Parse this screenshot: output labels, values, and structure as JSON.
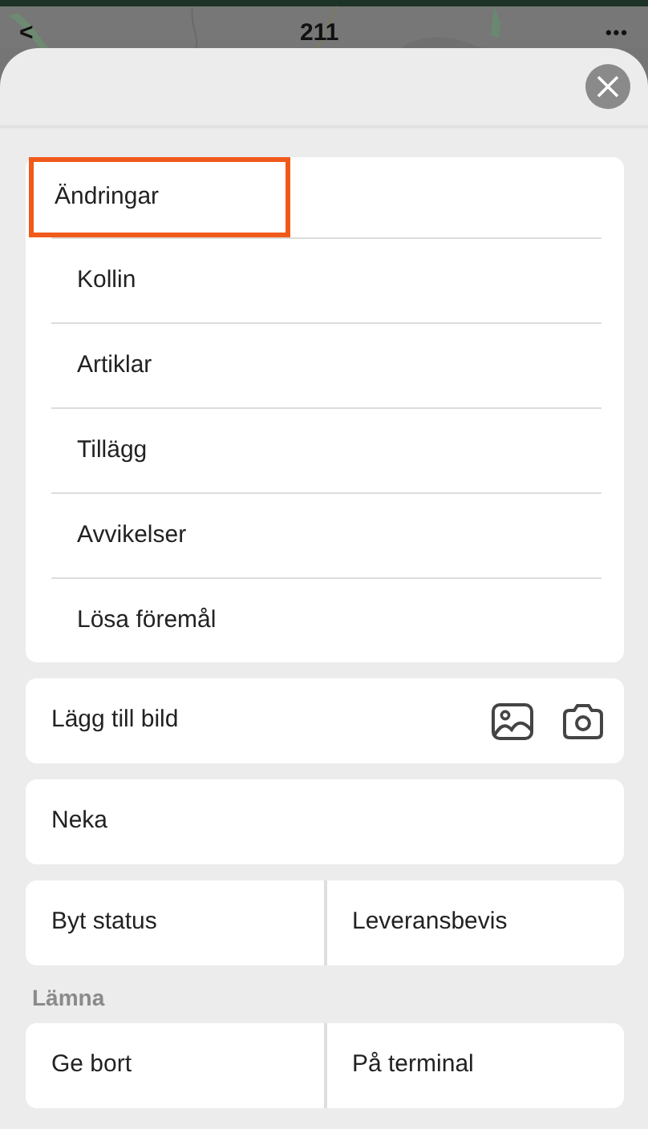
{
  "top_bar": {
    "back": "<",
    "title": "211",
    "more": "•••"
  },
  "menu": [
    {
      "label": "Ändringar",
      "highlighted": true
    },
    {
      "label": "Kollin",
      "highlighted": false
    },
    {
      "label": "Artiklar",
      "highlighted": false
    },
    {
      "label": "Tillägg",
      "highlighted": false
    },
    {
      "label": "Avvikelser",
      "highlighted": false
    },
    {
      "label": "Lösa föremål",
      "highlighted": false
    }
  ],
  "add_image": {
    "label": "Lägg till bild"
  },
  "deny": {
    "label": "Neka"
  },
  "actions": [
    "Byt status",
    "Leveransbevis"
  ],
  "leave": {
    "heading": "Lämna",
    "actions": [
      "Ge bort",
      "På terminal"
    ]
  }
}
